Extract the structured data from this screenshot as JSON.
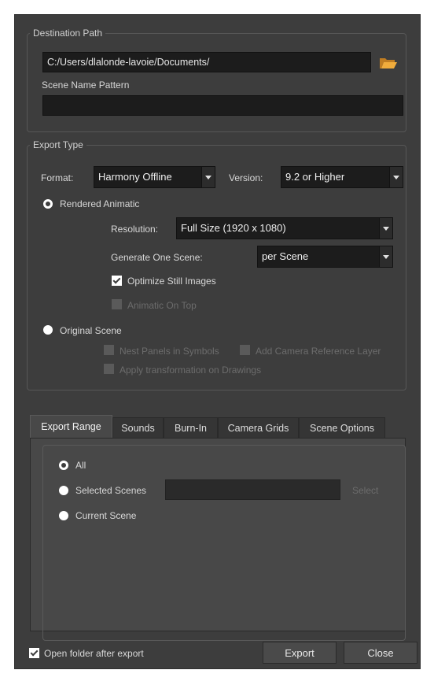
{
  "destination": {
    "group_title": "Destination Path",
    "path_value": "C:/Users/dlalonde-lavoie/Documents/",
    "scene_name_label": "Scene Name Pattern",
    "scene_name_value": ""
  },
  "export_type": {
    "group_title": "Export Type",
    "format_label": "Format:",
    "format_value": "Harmony Offline",
    "version_label": "Version:",
    "version_value": "9.2 or Higher",
    "rendered_animatic_label": "Rendered Animatic",
    "resolution_label": "Resolution:",
    "resolution_value": "Full Size (1920 x 1080)",
    "generate_label": "Generate One Scene:",
    "generate_value": "per Scene",
    "optimize_label": "Optimize Still Images",
    "animatic_on_top_label": "Animatic On Top",
    "original_scene_label": "Original Scene",
    "nest_panels_label": "Nest Panels in Symbols",
    "add_camera_label": "Add Camera Reference Layer",
    "apply_transform_label": "Apply transformation on Drawings"
  },
  "tabs": [
    {
      "label": "Export Range"
    },
    {
      "label": "Sounds"
    },
    {
      "label": "Burn-In"
    },
    {
      "label": "Camera Grids"
    },
    {
      "label": "Scene Options"
    }
  ],
  "export_range": {
    "all_label": "All",
    "selected_label": "Selected Scenes",
    "selected_value": "",
    "select_button": "Select",
    "current_label": "Current Scene"
  },
  "footer": {
    "open_folder_label": "Open folder after export",
    "export_button": "Export",
    "close_button": "Close"
  },
  "colors": {
    "dialog_bg": "#3d3d3d",
    "field_bg": "#1c1c1c",
    "folder_icon": "#e8a33a"
  }
}
